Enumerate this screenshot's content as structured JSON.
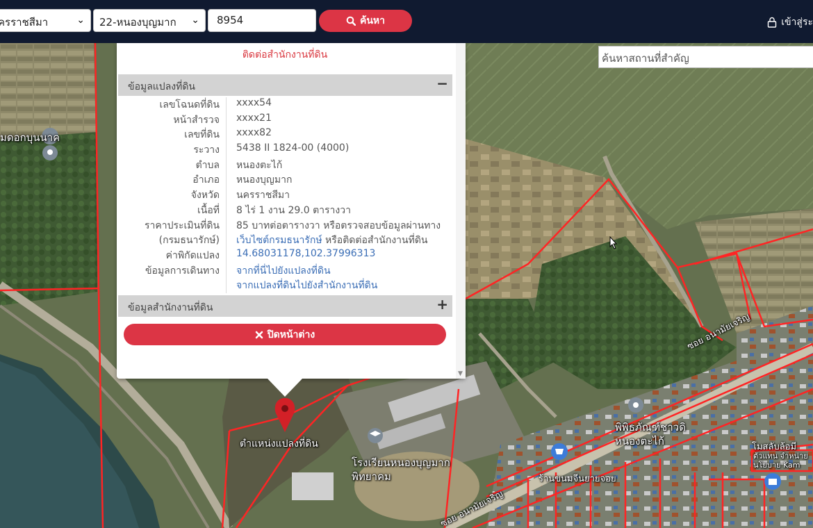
{
  "topbar": {
    "province": "ครราชสีมา",
    "district": "22-หนองบุญมาก",
    "parcel_number": "8954",
    "search_label": "ค้นหา",
    "login_label": "เข้าสู่ระ"
  },
  "place_search": {
    "placeholder": "ค้นหาสถานที่สำคัญ"
  },
  "popup": {
    "notice": "ติดต่อสำนักงานที่ดิน",
    "parcel_section_title": "ข้อมูลแปลงที่ดิน",
    "office_section_title": "ข้อมูลสำนักงานที่ดิน",
    "close_label": "ปิดหน้าต่าง",
    "rows": [
      {
        "label": "เลขโฉนดที่ดิน",
        "value": "xxxx54"
      },
      {
        "label": "หน้าสำรวจ",
        "value": "xxxx21"
      },
      {
        "label": "เลขที่ดิน",
        "value": "xxxx82"
      },
      {
        "label": "ระวาง",
        "value": "5438 II 1824-00 (4000)"
      },
      {
        "label": "ตำบล",
        "value": "หนองตะไก้"
      },
      {
        "label": "อำเภอ",
        "value": "หนองบุญมาก"
      },
      {
        "label": "จังหวัด",
        "value": "นครราชสีมา"
      },
      {
        "label": "เนื้อที่",
        "value": "8 ไร่ 1 งาน 29.0 ตารางวา"
      },
      {
        "label": "ราคาประเมินที่ดิน",
        "value": "85 บาทต่อตารางวา หรือตรวจสอบข้อมูลผ่านทาง"
      },
      {
        "label": "(กรมธนารักษ์)",
        "value_link": "เว็บไซต์กรมธนารักษ์",
        "value_suffix": " หรือติดต่อสำนักงานที่ดิน"
      },
      {
        "label": "ค่าพิกัดแปลง",
        "value_link": "14.68031178,102.37996313"
      },
      {
        "label": "ข้อมูลการเดินทาง",
        "value_link": "จากที่นี่ไปยังแปลงที่ดิน"
      },
      {
        "label": "",
        "value_link": "จากแปลงที่ดินไปยังสำนักงานที่ดิน"
      }
    ]
  },
  "map": {
    "marker_label": "ตำแหน่งแปลงที่ดิน",
    "labels": {
      "temple": "มดอกบุนนาค",
      "school": "โรงเรียนหนองบุญมาก\nพิทยาคม",
      "museum": "พิพิธภัณฑ์ชาวดิ\nหนองตะไก้",
      "road_north": "ซอย อนามัยเจริญ",
      "road_south": "ซอย อนามัยเจริญ",
      "shop": "ร้านขนมจีนยายจอย",
      "east_poi": "โมสลับล้อมี",
      "east_poi2": "ตัวแทน จำหน่าย\nนโยบาย Kam"
    }
  }
}
